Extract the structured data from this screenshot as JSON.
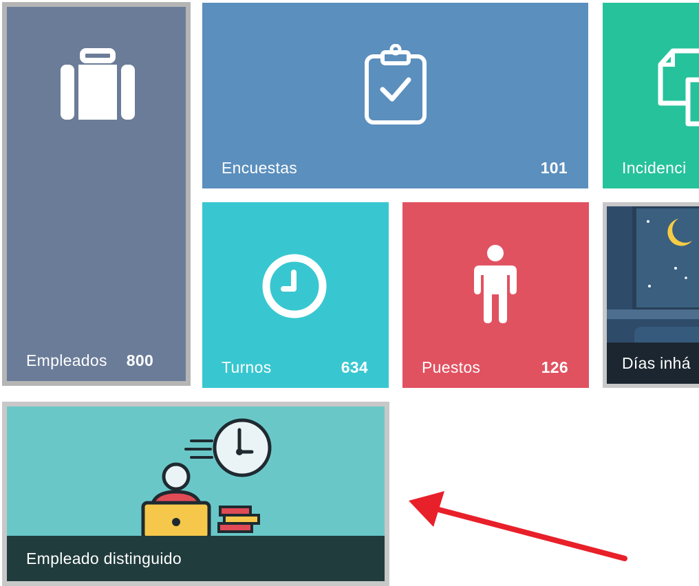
{
  "tiles": {
    "empleados": {
      "label": "Empleados",
      "count": "800",
      "icon": "briefcase-icon",
      "color": "#6a7c98"
    },
    "encuestas": {
      "label": "Encuestas",
      "count": "101",
      "icon": "clipboard-check-icon",
      "color": "#5b8fbd"
    },
    "incidencias": {
      "label": "Incidenci",
      "icon": "documents-icon",
      "color": "#26c29b"
    },
    "turnos": {
      "label": "Turnos",
      "count": "634",
      "icon": "clock-icon",
      "color": "#38c7d0"
    },
    "puestos": {
      "label": "Puestos",
      "count": "126",
      "icon": "person-icon",
      "color": "#e15261"
    },
    "dias_inhabiles": {
      "label": "Días inhá",
      "icon": "night-window-illustration",
      "color": "#2f4b6a"
    },
    "empleado_distinguido": {
      "label": "Empleado distinguido",
      "icon": "employee-at-desk-illustration",
      "color": "#6ac7c8"
    }
  },
  "annotation": {
    "icon": "red-arrow-icon",
    "color": "#e8202a"
  }
}
